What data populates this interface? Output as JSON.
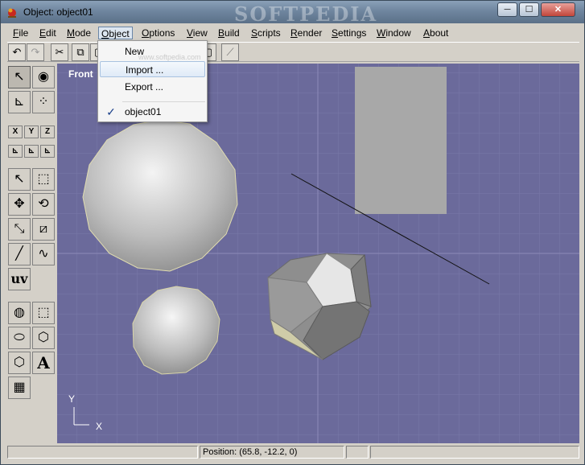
{
  "window": {
    "title": "Object: object01",
    "watermark": "SOFTPEDIA"
  },
  "controls": {
    "minimize": "─",
    "maximize": "☐",
    "close": "✕"
  },
  "menu": {
    "items": [
      {
        "mn": "F",
        "rest": "ile"
      },
      {
        "mn": "E",
        "rest": "dit"
      },
      {
        "mn": "M",
        "rest": "ode"
      },
      {
        "mn": "O",
        "rest": "bject"
      },
      {
        "mn": "O",
        "rest": "ptions"
      },
      {
        "mn": "V",
        "rest": "iew"
      },
      {
        "mn": "B",
        "rest": "uild"
      },
      {
        "mn": "S",
        "rest": "cripts"
      },
      {
        "mn": "R",
        "rest": "ender"
      },
      {
        "mn": "S",
        "rest": "ettings"
      },
      {
        "mn": "W",
        "rest": "indow"
      },
      {
        "mn": "A",
        "rest": "bout"
      }
    ]
  },
  "toolbar": {
    "undo": "↶",
    "redo": "↷",
    "cut": "✂",
    "copy": "⧉",
    "paste": "▢",
    "graph": "⟋"
  },
  "object_menu": {
    "items": [
      "New",
      "Import ...",
      "Export ...",
      "object01"
    ],
    "checked": "✓",
    "watermark": "www.softpedia.com"
  },
  "tools": {
    "select": "↖",
    "eye": "◉",
    "axes": "⊾",
    "points": "⁘",
    "x": "X",
    "y": "Y",
    "z": "Z",
    "arrow": "↖",
    "rect": "⬚",
    "move": "✥",
    "rotate": "⟲",
    "scale": "⤡",
    "skew": "⧄",
    "line": "╱",
    "curve": "∿",
    "uv": "uv",
    "sphere": "◍",
    "cube": "⬚",
    "cylinder": "⬭",
    "polyhedron": "⬡",
    "hexagon": "⬡",
    "text": "A",
    "table": "▦"
  },
  "viewport": {
    "label": "Front",
    "axis_y": "Y",
    "axis_x": "X",
    "background": "#6b6a9b"
  },
  "status": {
    "position": "Position: (65.8, -12.2, 0)"
  }
}
